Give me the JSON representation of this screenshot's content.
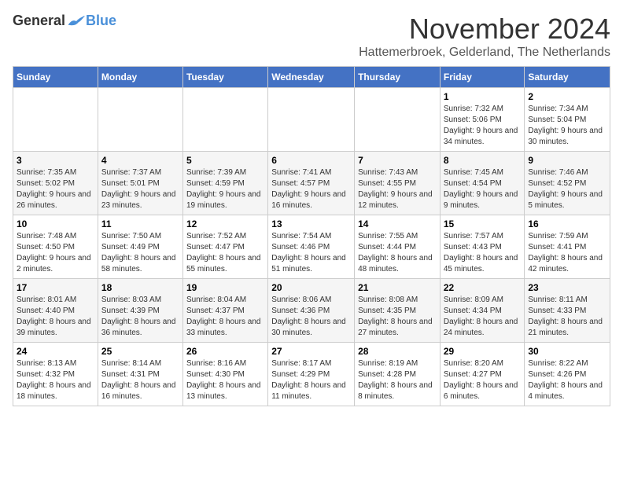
{
  "logo": {
    "general": "General",
    "blue": "Blue"
  },
  "title": "November 2024",
  "location": "Hattemerbroek, Gelderland, The Netherlands",
  "days_of_week": [
    "Sunday",
    "Monday",
    "Tuesday",
    "Wednesday",
    "Thursday",
    "Friday",
    "Saturday"
  ],
  "weeks": [
    [
      {
        "day": "",
        "info": ""
      },
      {
        "day": "",
        "info": ""
      },
      {
        "day": "",
        "info": ""
      },
      {
        "day": "",
        "info": ""
      },
      {
        "day": "",
        "info": ""
      },
      {
        "day": "1",
        "info": "Sunrise: 7:32 AM\nSunset: 5:06 PM\nDaylight: 9 hours and 34 minutes."
      },
      {
        "day": "2",
        "info": "Sunrise: 7:34 AM\nSunset: 5:04 PM\nDaylight: 9 hours and 30 minutes."
      }
    ],
    [
      {
        "day": "3",
        "info": "Sunrise: 7:35 AM\nSunset: 5:02 PM\nDaylight: 9 hours and 26 minutes."
      },
      {
        "day": "4",
        "info": "Sunrise: 7:37 AM\nSunset: 5:01 PM\nDaylight: 9 hours and 23 minutes."
      },
      {
        "day": "5",
        "info": "Sunrise: 7:39 AM\nSunset: 4:59 PM\nDaylight: 9 hours and 19 minutes."
      },
      {
        "day": "6",
        "info": "Sunrise: 7:41 AM\nSunset: 4:57 PM\nDaylight: 9 hours and 16 minutes."
      },
      {
        "day": "7",
        "info": "Sunrise: 7:43 AM\nSunset: 4:55 PM\nDaylight: 9 hours and 12 minutes."
      },
      {
        "day": "8",
        "info": "Sunrise: 7:45 AM\nSunset: 4:54 PM\nDaylight: 9 hours and 9 minutes."
      },
      {
        "day": "9",
        "info": "Sunrise: 7:46 AM\nSunset: 4:52 PM\nDaylight: 9 hours and 5 minutes."
      }
    ],
    [
      {
        "day": "10",
        "info": "Sunrise: 7:48 AM\nSunset: 4:50 PM\nDaylight: 9 hours and 2 minutes."
      },
      {
        "day": "11",
        "info": "Sunrise: 7:50 AM\nSunset: 4:49 PM\nDaylight: 8 hours and 58 minutes."
      },
      {
        "day": "12",
        "info": "Sunrise: 7:52 AM\nSunset: 4:47 PM\nDaylight: 8 hours and 55 minutes."
      },
      {
        "day": "13",
        "info": "Sunrise: 7:54 AM\nSunset: 4:46 PM\nDaylight: 8 hours and 51 minutes."
      },
      {
        "day": "14",
        "info": "Sunrise: 7:55 AM\nSunset: 4:44 PM\nDaylight: 8 hours and 48 minutes."
      },
      {
        "day": "15",
        "info": "Sunrise: 7:57 AM\nSunset: 4:43 PM\nDaylight: 8 hours and 45 minutes."
      },
      {
        "day": "16",
        "info": "Sunrise: 7:59 AM\nSunset: 4:41 PM\nDaylight: 8 hours and 42 minutes."
      }
    ],
    [
      {
        "day": "17",
        "info": "Sunrise: 8:01 AM\nSunset: 4:40 PM\nDaylight: 8 hours and 39 minutes."
      },
      {
        "day": "18",
        "info": "Sunrise: 8:03 AM\nSunset: 4:39 PM\nDaylight: 8 hours and 36 minutes."
      },
      {
        "day": "19",
        "info": "Sunrise: 8:04 AM\nSunset: 4:37 PM\nDaylight: 8 hours and 33 minutes."
      },
      {
        "day": "20",
        "info": "Sunrise: 8:06 AM\nSunset: 4:36 PM\nDaylight: 8 hours and 30 minutes."
      },
      {
        "day": "21",
        "info": "Sunrise: 8:08 AM\nSunset: 4:35 PM\nDaylight: 8 hours and 27 minutes."
      },
      {
        "day": "22",
        "info": "Sunrise: 8:09 AM\nSunset: 4:34 PM\nDaylight: 8 hours and 24 minutes."
      },
      {
        "day": "23",
        "info": "Sunrise: 8:11 AM\nSunset: 4:33 PM\nDaylight: 8 hours and 21 minutes."
      }
    ],
    [
      {
        "day": "24",
        "info": "Sunrise: 8:13 AM\nSunset: 4:32 PM\nDaylight: 8 hours and 18 minutes."
      },
      {
        "day": "25",
        "info": "Sunrise: 8:14 AM\nSunset: 4:31 PM\nDaylight: 8 hours and 16 minutes."
      },
      {
        "day": "26",
        "info": "Sunrise: 8:16 AM\nSunset: 4:30 PM\nDaylight: 8 hours and 13 minutes."
      },
      {
        "day": "27",
        "info": "Sunrise: 8:17 AM\nSunset: 4:29 PM\nDaylight: 8 hours and 11 minutes."
      },
      {
        "day": "28",
        "info": "Sunrise: 8:19 AM\nSunset: 4:28 PM\nDaylight: 8 hours and 8 minutes."
      },
      {
        "day": "29",
        "info": "Sunrise: 8:20 AM\nSunset: 4:27 PM\nDaylight: 8 hours and 6 minutes."
      },
      {
        "day": "30",
        "info": "Sunrise: 8:22 AM\nSunset: 4:26 PM\nDaylight: 8 hours and 4 minutes."
      }
    ]
  ]
}
